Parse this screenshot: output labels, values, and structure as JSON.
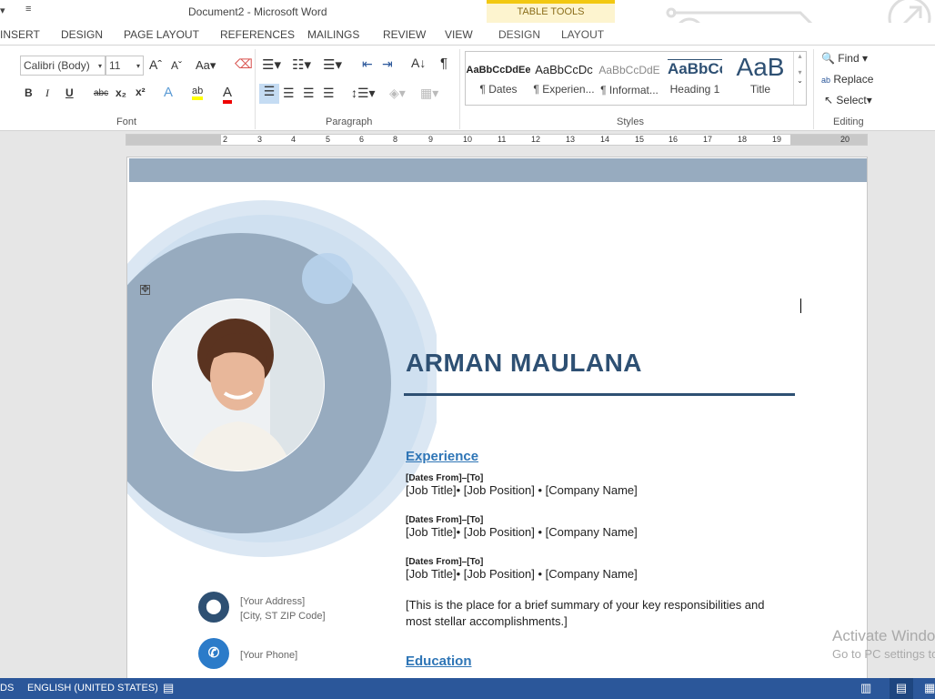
{
  "window": {
    "title": "Document2 - Microsoft Word"
  },
  "tabs": [
    "INSERT",
    "DESIGN",
    "PAGE LAYOUT",
    "REFERENCES",
    "MAILINGS",
    "REVIEW",
    "VIEW"
  ],
  "context_tabs": {
    "group": "TABLE TOOLS",
    "tabs": [
      "DESIGN",
      "LAYOUT"
    ]
  },
  "font": {
    "name": "Calibri (Body)",
    "size": "11",
    "group_label": "Font"
  },
  "paragraph": {
    "group_label": "Paragraph"
  },
  "styles": {
    "group_label": "Styles",
    "items": [
      {
        "preview": "AaBbCcDdEe",
        "label": "¶ Dates"
      },
      {
        "preview": "AaBbCcDc",
        "label": "¶ Experien..."
      },
      {
        "preview": "AaBbCcDdE",
        "label": "¶ Informat..."
      },
      {
        "preview": "AaBbCc",
        "label": "Heading 1"
      },
      {
        "preview": "AaB",
        "label": "Title"
      }
    ]
  },
  "editing": {
    "group_label": "Editing",
    "find": "Find",
    "replace": "Replace",
    "select": "Select"
  },
  "ruler": [
    "2",
    "3",
    "4",
    "5",
    "6",
    "8",
    "9",
    "10",
    "11",
    "12",
    "13",
    "14",
    "15",
    "16",
    "17",
    "18",
    "19",
    "20"
  ],
  "resume": {
    "name": "ARMAN MAULANA",
    "experience_heading": "Experience",
    "experience": [
      {
        "dates": "[Dates From]–[To]",
        "line": "[Job Title]• [Job Position] • [Company Name]"
      },
      {
        "dates": "[Dates From]–[To]",
        "line": "[Job Title]• [Job Position] • [Company Name]"
      },
      {
        "dates": "[Dates From]–[To]",
        "line": "[Job Title]• [Job Position] • [Company Name]"
      }
    ],
    "summary": "[This is the place for a brief summary of your key responsibilities and most stellar accomplishments.]",
    "education_heading": "Education",
    "address1": "[Your Address]",
    "address2": "[City, ST ZIP Code]",
    "phone": "[Your Phone]",
    "accent": "#2e5073",
    "band": "#97abbf"
  },
  "watermark": {
    "line1": "Activate Windows",
    "line2": "Go to PC settings to activate Windows."
  },
  "status": {
    "left": "DS",
    "language": "ENGLISH (UNITED STATES)"
  }
}
